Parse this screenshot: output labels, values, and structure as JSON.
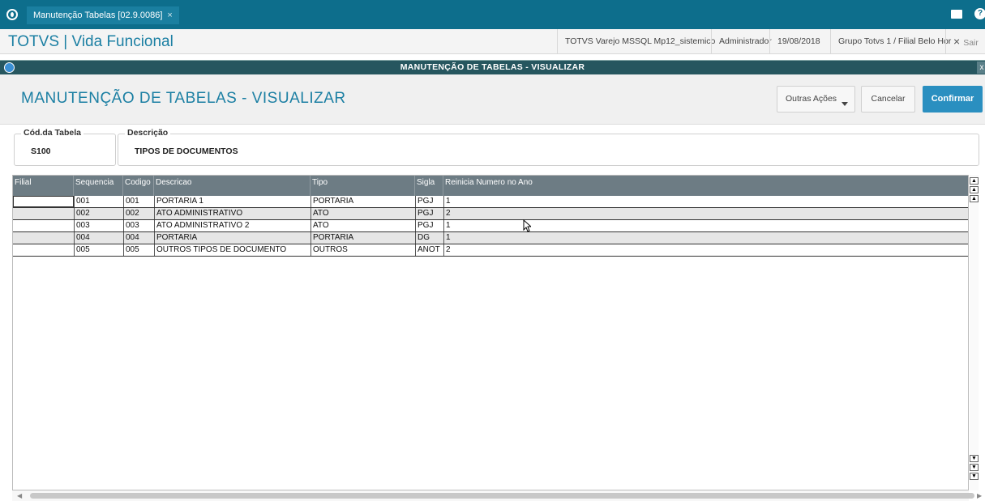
{
  "tab": {
    "label": "Manutenção Tabelas [02.9.0086]",
    "close": "×"
  },
  "app": {
    "title": "TOTVS | Vida Funcional",
    "environment": "TOTVS Varejo MSSQL Mp12_sistemico",
    "user": "Administrador",
    "date": "19/08/2018",
    "company": "Grupo Totvs 1 / Filial Belo Hor",
    "exit": "Sair",
    "exit_icon": "×"
  },
  "dialog": {
    "title": "MANUTENÇÃO DE TABELAS - VISUALIZAR",
    "close": "x"
  },
  "page": {
    "title": "MANUTENÇÃO DE TABELAS - VISUALIZAR",
    "buttons": {
      "outras": "Outras Ações",
      "cancel": "Cancelar",
      "confirm": "Confirmar"
    }
  },
  "fields": {
    "cod": {
      "label": "Cód.da Tabela",
      "value": "S100"
    },
    "desc": {
      "label": "Descrição",
      "value": "TIPOS DE DOCUMENTOS"
    }
  },
  "grid": {
    "columns": [
      "Filial",
      "Sequencia",
      "Codigo",
      "Descricao",
      "Tipo",
      "Sigla",
      "Reinicia Numero no Ano"
    ],
    "rows": [
      [
        "",
        "001",
        "001",
        "PORTARIA 1",
        "PORTARIA",
        "PGJ",
        "1"
      ],
      [
        "",
        "002",
        "002",
        "ATO ADMINISTRATIVO",
        "ATO",
        "PGJ",
        "2"
      ],
      [
        "",
        "003",
        "003",
        "ATO ADMINISTRATIVO 2",
        "ATO",
        "PGJ",
        "1"
      ],
      [
        "",
        "004",
        "004",
        "PORTARIA",
        "PORTARIA",
        "DG",
        "1"
      ],
      [
        "",
        "005",
        "005",
        "OUTROS TIPOS DE DOCUMENTO",
        "OUTROS",
        "ANOT",
        "2"
      ]
    ]
  },
  "colors": {
    "tabbar": "#0d6e8c",
    "accent": "#1b7fa3",
    "confirm": "#2a8fc0",
    "grid_header": "#6d7c84"
  }
}
